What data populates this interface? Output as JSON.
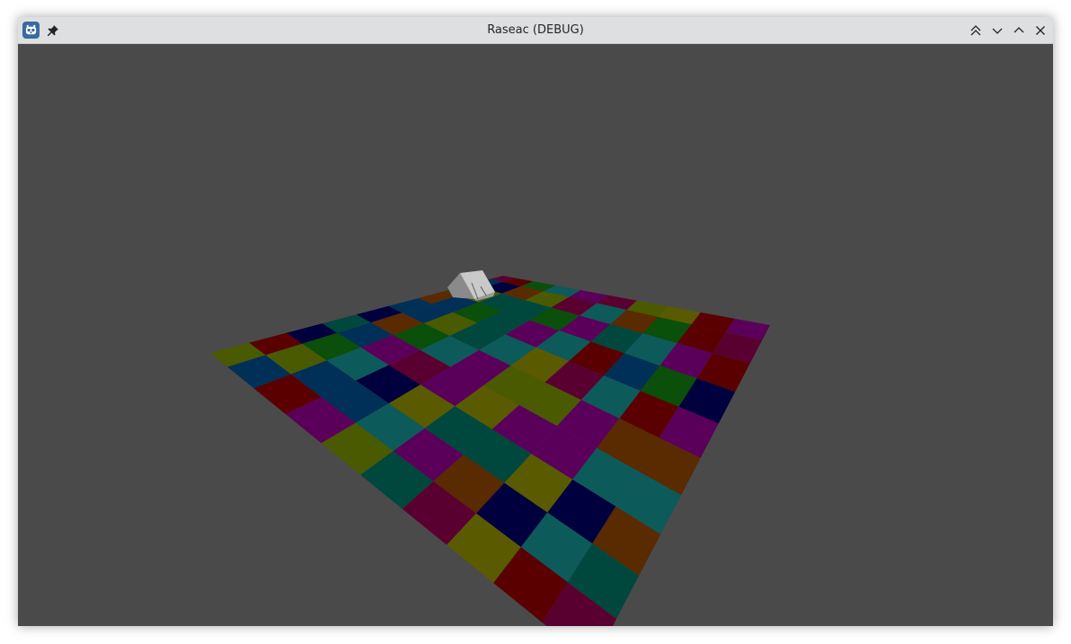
{
  "window": {
    "title": "Raseac (DEBUG)",
    "app_icon": "godot-icon",
    "controls": [
      "keep-above-icon",
      "minimize-icon",
      "maximize-icon",
      "close-icon"
    ]
  },
  "scene": {
    "background_color": "#4a4a4a",
    "board_columns": 10,
    "board_rows": 10,
    "object": "tent",
    "tile_colors": [
      "#4a5a00",
      "#0a4f0a",
      "#0d5a5a",
      "#003058",
      "#5a005a",
      "#5a0030",
      "#5a0000",
      "#5a2a00",
      "#00003f",
      "#5a5a00",
      "#00483d"
    ]
  }
}
